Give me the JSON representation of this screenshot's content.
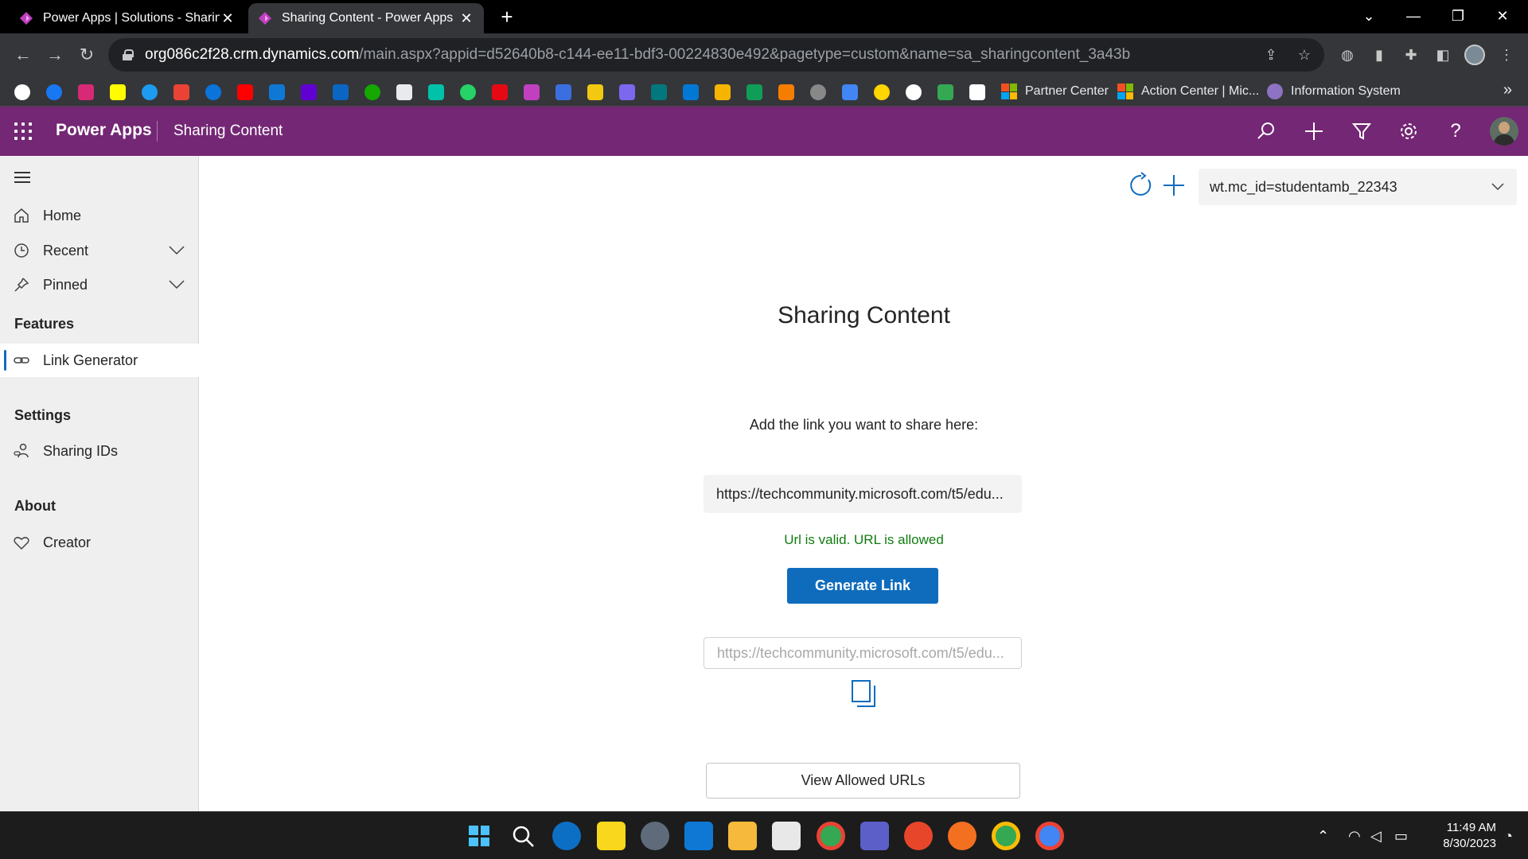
{
  "browser": {
    "tabs": [
      {
        "title": "Power Apps | Solutions - Sharing",
        "active": false
      },
      {
        "title": "Sharing Content - Power Apps",
        "active": true
      }
    ],
    "url_host": "org086c2f28.crm.dynamics.com",
    "url_path": "/main.aspx?appid=d52640b8-c144-ee11-bdf3-00224830e492&pagetype=custom&name=sa_sharingcontent_3a43b",
    "bookmarks": [
      {
        "label": "Partner Center"
      },
      {
        "label": "Action Center | Mic..."
      },
      {
        "label": "Information System"
      }
    ]
  },
  "header": {
    "app_name": "Power Apps",
    "page_name": "Sharing Content"
  },
  "sidebar": {
    "items": [
      {
        "label": "Home",
        "icon": "home-icon"
      },
      {
        "label": "Recent",
        "icon": "clock-icon"
      },
      {
        "label": "Pinned",
        "icon": "pin-icon"
      }
    ],
    "groups": [
      {
        "title": "Features",
        "items": [
          {
            "label": "Link Generator",
            "icon": "link-icon",
            "selected": true
          }
        ]
      },
      {
        "title": "Settings",
        "items": [
          {
            "label": "Sharing IDs",
            "icon": "people-link-icon"
          }
        ]
      },
      {
        "title": "About",
        "items": [
          {
            "label": "Creator",
            "icon": "heart-icon"
          }
        ]
      }
    ]
  },
  "main": {
    "tracking_id": "wt.mc_id=studentamb_22343",
    "title": "Sharing Content",
    "prompt": "Add the link you want to share here:",
    "input_value": "https://techcommunity.microsoft.com/t5/edu...",
    "validation": "Url is valid. URL is allowed",
    "generate_label": "Generate Link",
    "output_placeholder": "https://techcommunity.microsoft.com/t5/edu...",
    "view_urls_label": "View Allowed URLs"
  },
  "taskbar": {
    "time": "11:49 AM",
    "date": "8/30/2023"
  },
  "colors": {
    "brand": "#742774",
    "primary": "#0f6cbd",
    "success": "#107c10"
  }
}
